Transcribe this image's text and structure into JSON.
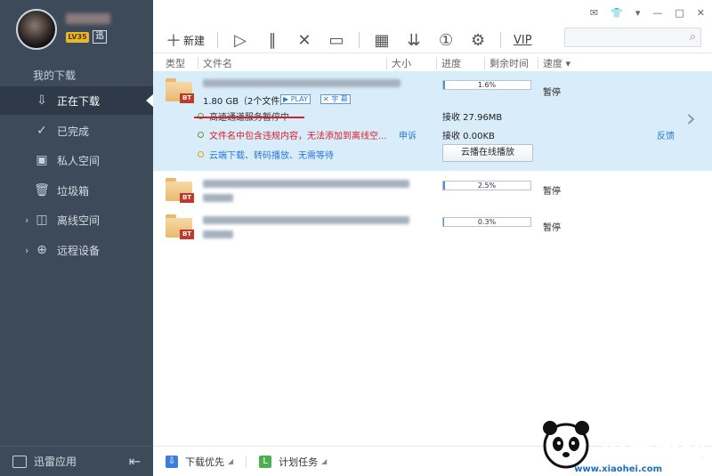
{
  "sidebar": {
    "level": "LV35",
    "section_title": "我的下载",
    "items": [
      {
        "label": "正在下载",
        "icon": "download-arrow-icon"
      },
      {
        "label": "已完成",
        "icon": "check-circle-icon"
      },
      {
        "label": "私人空间",
        "icon": "lock-box-icon"
      },
      {
        "label": "垃圾箱",
        "icon": "trash-icon"
      },
      {
        "label": "离线空间",
        "icon": "offline-space-icon"
      },
      {
        "label": "远程设备",
        "icon": "remote-device-icon"
      }
    ],
    "bottom_label": "迅雷应用"
  },
  "toolbar": {
    "new_label": "新建",
    "vip_label": "VIP"
  },
  "columns": {
    "type": "类型",
    "filename": "文件名",
    "size": "大小",
    "progress": "进度",
    "remaining": "剩余时间",
    "speed": "速度"
  },
  "tasks": [
    {
      "size_text": "1.80 GB（2个文件）",
      "play_tag": "PLAY",
      "sub_tag": "字 幕",
      "progress_text": "1.6%",
      "progress": 0.016,
      "status": "暂停",
      "info1": "高速通道服务暂停中",
      "info2": "文件名中包含违规内容，无法添加到离线空...",
      "appeal": "申诉",
      "info3": "云端下载、转码播放、无需等待",
      "recv1": "接收 27.96MB",
      "recv2": "接收 0.00KB",
      "cloud_button": "云播在线播放",
      "feedback": "反馈",
      "type_badge": "BT"
    },
    {
      "progress_text": "2.5%",
      "progress": 0.025,
      "status": "暂停",
      "type_badge": "BT"
    },
    {
      "progress_text": "0.3%",
      "progress": 0.003,
      "status": "暂停",
      "type_badge": "BT"
    }
  ],
  "bottombar": {
    "download_priority": "下载优先",
    "scheduled_task": "计划任务"
  },
  "watermark": {
    "text": "小黑游戏",
    "url": "www.xiaohei.com"
  },
  "colors": {
    "sidebar_bg": "#3c4a5a",
    "selected_row": "#d9ecfa",
    "progress_fill": "#4a90d9",
    "error_red": "#d8202a",
    "link_blue": "#2a7ad5"
  }
}
